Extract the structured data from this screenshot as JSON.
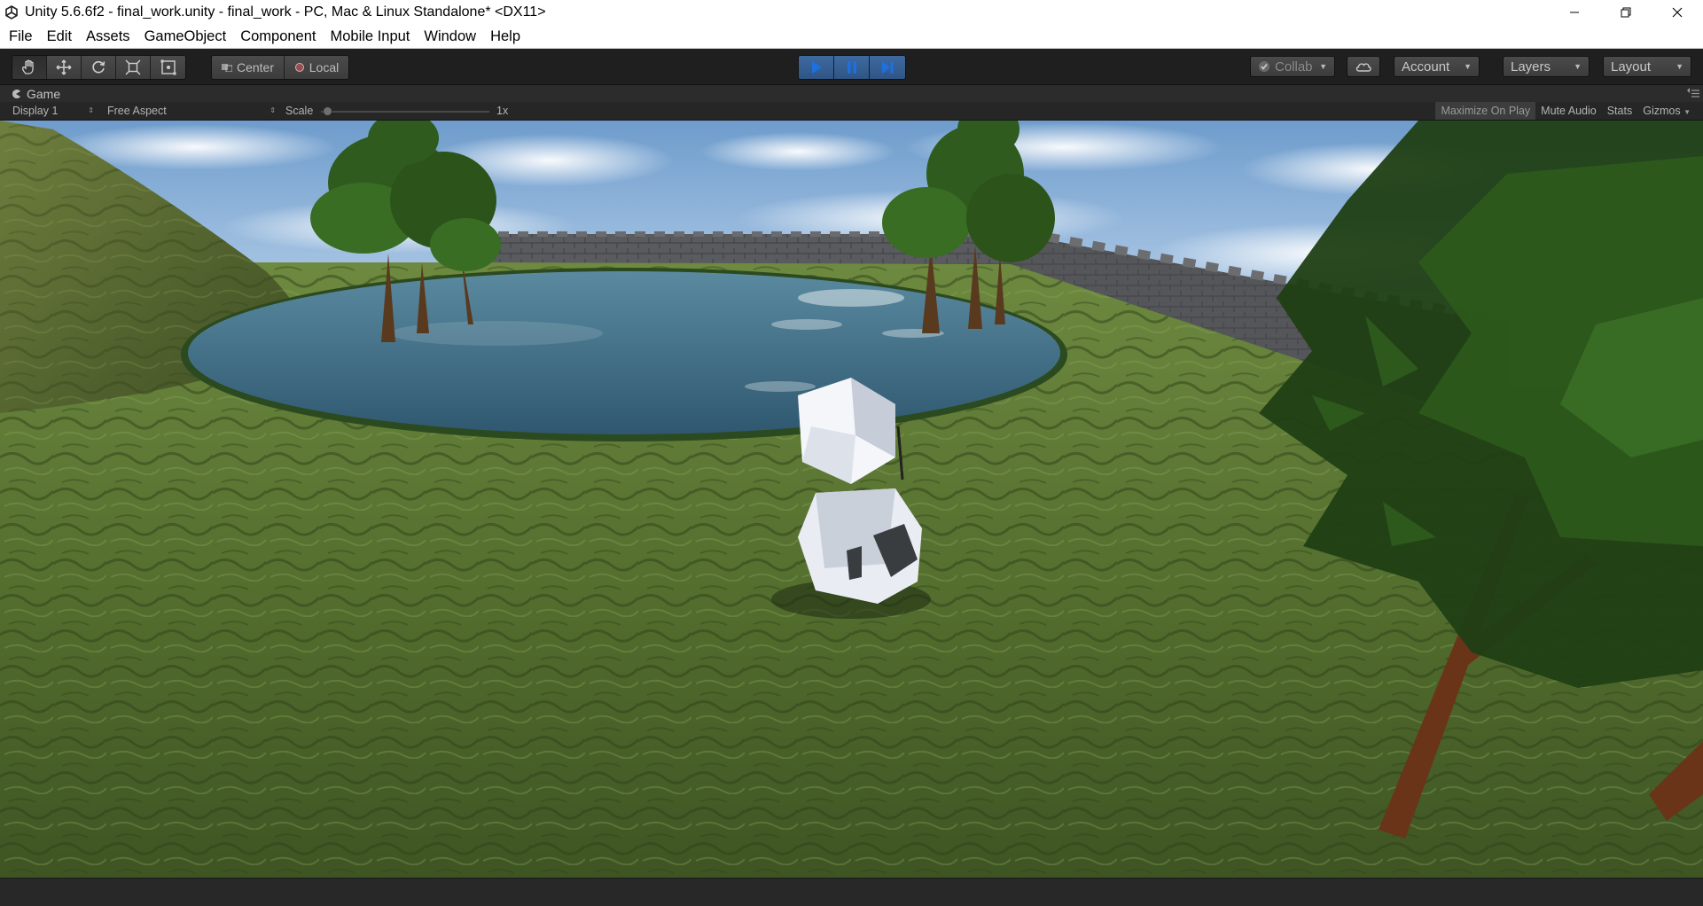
{
  "window": {
    "title": "Unity 5.6.6f2 - final_work.unity - final_work - PC, Mac & Linux Standalone* <DX11>"
  },
  "menu": [
    {
      "id": "file",
      "label": "File"
    },
    {
      "id": "edit",
      "label": "Edit"
    },
    {
      "id": "assets",
      "label": "Assets"
    },
    {
      "id": "gameobject",
      "label": "GameObject"
    },
    {
      "id": "component",
      "label": "Component"
    },
    {
      "id": "mobile-input",
      "label": "Mobile Input"
    },
    {
      "id": "window",
      "label": "Window"
    },
    {
      "id": "help",
      "label": "Help"
    }
  ],
  "toolbar": {
    "tools": [
      "hand-icon",
      "move-icon",
      "rotate-icon",
      "scale-icon",
      "rect-tool-icon"
    ],
    "pivot_mode": "Center",
    "pivot_rotation": "Local",
    "playback": [
      "play-icon",
      "pause-icon",
      "step-icon"
    ],
    "play_active": true,
    "collab": "Collab",
    "account": "Account",
    "layers": "Layers",
    "layout": "Layout"
  },
  "game_view": {
    "tab_label": "Game",
    "display": "Display 1",
    "aspect": "Free Aspect",
    "scale_label": "Scale",
    "scale_value": "1x",
    "toggles": {
      "maximize_on_play": "Maximize On Play",
      "mute_audio": "Mute Audio",
      "stats": "Stats",
      "gizmos": "Gizmos"
    }
  },
  "colors": {
    "toolbar_bg": "#1f1f1f",
    "play_active": "#3e6aa0",
    "grass": "#4e6a2e",
    "water": "#3f6a80",
    "sky": "#8fb3d9"
  }
}
